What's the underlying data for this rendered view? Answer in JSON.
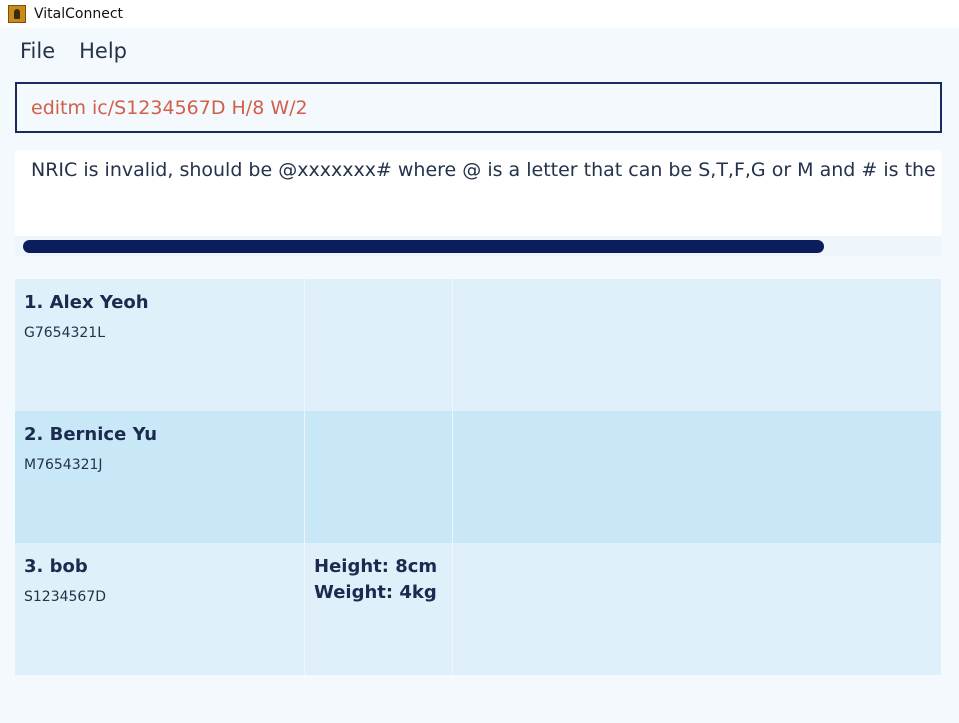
{
  "window": {
    "title": "VitalConnect",
    "icon": "address-book-icon"
  },
  "menu": {
    "items": [
      "File",
      "Help"
    ]
  },
  "command": {
    "text": "editm ic/S1234567D H/8 W/2"
  },
  "result": {
    "message": "NRIC is invalid, should be @xxxxxxx# where @ is a letter that can be S,T,F,G or M and # is the appropriate checksum letter"
  },
  "progress": {
    "fraction": 0.88
  },
  "patients": [
    {
      "index_name": "1. Alex Yeoh",
      "nric": "G7654321L",
      "height": "",
      "weight": ""
    },
    {
      "index_name": "2. Bernice Yu",
      "nric": "M7654321J",
      "height": "",
      "weight": ""
    },
    {
      "index_name": "3. bob",
      "nric": "S1234567D",
      "height": "Height: 8cm",
      "weight": "Weight: 4kg"
    }
  ],
  "colors": {
    "accent": "#0c1d5e",
    "command_text": "#d0604a",
    "row_odd": "#dff0fa",
    "row_even": "#c8e8f8"
  }
}
